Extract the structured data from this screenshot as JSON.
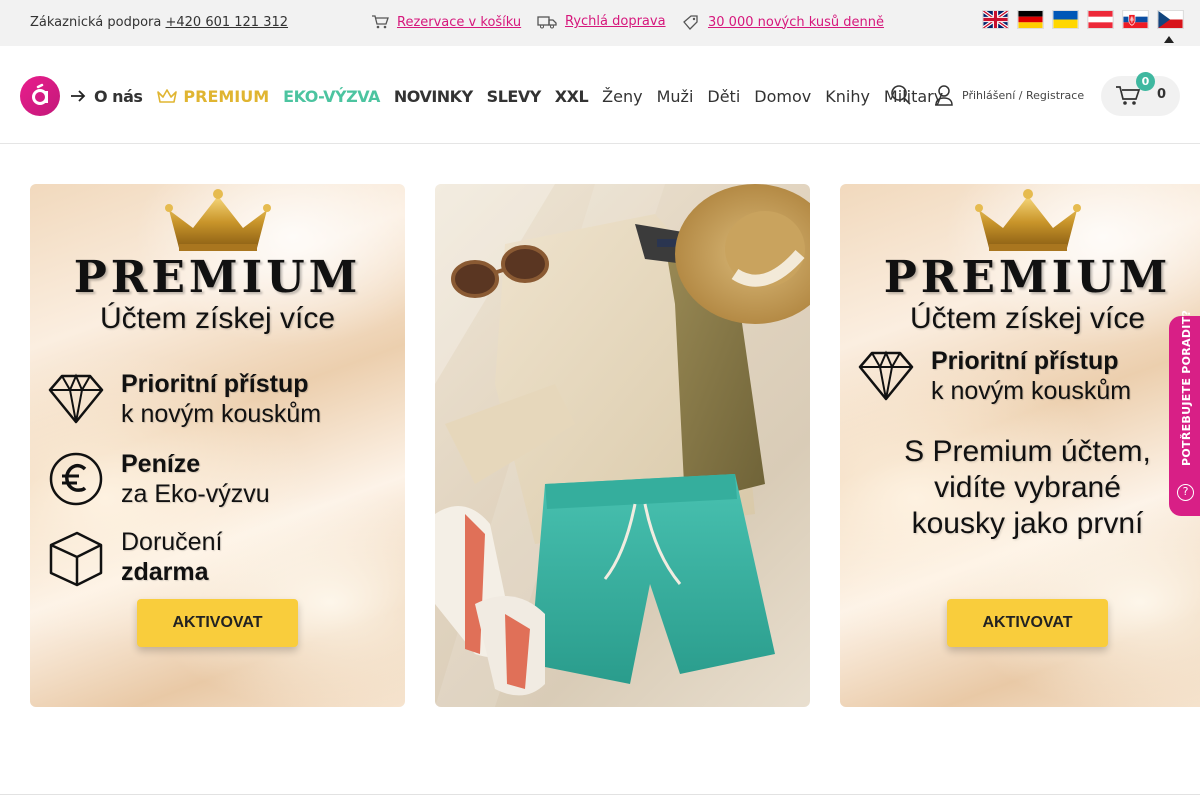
{
  "topbar": {
    "support_label": "Zákaznická podpora",
    "support_phone": "+420 601 121 312",
    "promos": [
      {
        "label": "Rezervace v košíku",
        "icon": "cart-icon"
      },
      {
        "label": "Rychlá doprava",
        "icon": "truck-icon"
      },
      {
        "label": "30 000 nových kusů denně",
        "icon": "tag-icon"
      }
    ],
    "languages": [
      "English",
      "Deutsch",
      "Українська",
      "Österreich",
      "Slovenčina",
      "Čeština"
    ]
  },
  "nav": {
    "about": "O nás",
    "premium": "PREMIUM",
    "eko": "EKO-VÝZVA",
    "novinky": "NOVINKY",
    "slevy": "SLEVY",
    "xxl": "XXL",
    "zeny": "Ženy",
    "muzi": "Muži",
    "deti": "Děti",
    "domov": "Domov",
    "knihy": "Knihy",
    "military": "Military"
  },
  "account": {
    "label": "Přihlášení / Registrace"
  },
  "cart": {
    "badge": "0",
    "count": "0"
  },
  "banners": {
    "premium_title": "PREMIUM",
    "premium_subtitle": "Účtem získej více",
    "feature1_line1": "Prioritní přístup",
    "feature1_line2": "k novým kouskům",
    "feature2_line1": "Peníze",
    "feature2_line2": "za Eko-výzvu",
    "feature3_line1": "Doručení",
    "feature3_line2": "zdarma",
    "cta": "AKTIVOVAT",
    "b3_line1": "S Premium účtem,",
    "b3_line2": "vidíte vybrané",
    "b3_line3": "kousky jako první"
  },
  "help": {
    "label": "POTŘEBUJETE PORADIT?",
    "icon": "?"
  },
  "colors": {
    "brand": "#d81f86",
    "premium_gold": "#e0b531",
    "eko_green": "#4cc4a0",
    "cta_yellow": "#f9cd3c",
    "badge_teal": "#3fb8a0"
  }
}
